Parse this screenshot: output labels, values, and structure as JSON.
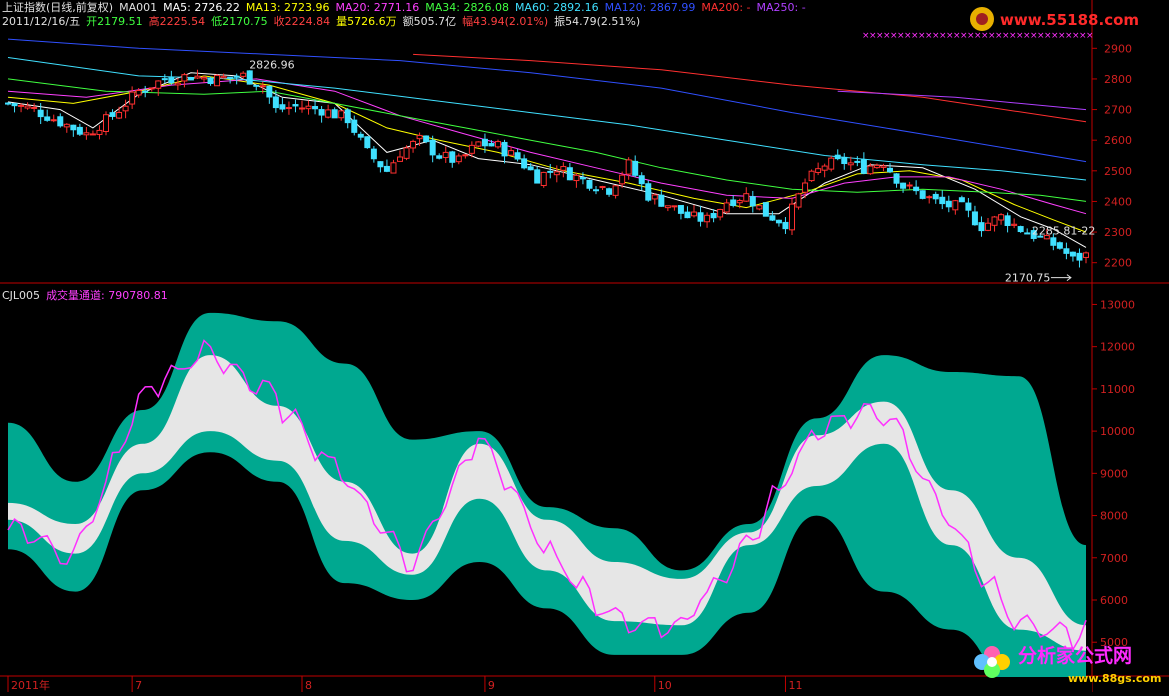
{
  "header": {
    "line1": [
      {
        "text": "上证指数(日线,前复权)",
        "color": "#e0e0e0"
      },
      {
        "text": "MA001",
        "color": "#e0e0e0"
      },
      {
        "text": "MA5: 2726.22",
        "color": "#ffffff"
      },
      {
        "text": "MA13: 2723.96",
        "color": "#ffff00"
      },
      {
        "text": "MA20: 2771.16",
        "color": "#ff40ff"
      },
      {
        "text": "MA34: 2826.08",
        "color": "#40ff40"
      },
      {
        "text": "MA60: 2892.16",
        "color": "#40e0ff"
      },
      {
        "text": "MA120: 2867.99",
        "color": "#3050ff"
      },
      {
        "text": "MA200: -",
        "color": "#ff3030"
      },
      {
        "text": "MA250: -",
        "color": "#b040ff"
      }
    ],
    "line2": [
      {
        "text": "2011/12/16/五",
        "color": "#e0e0e0"
      },
      {
        "text": "开2179.51",
        "color": "#40ff40"
      },
      {
        "text": "高2225.54",
        "color": "#ff4040"
      },
      {
        "text": "低2170.75",
        "color": "#40ff40"
      },
      {
        "text": "收2224.84",
        "color": "#ff4040"
      },
      {
        "text": "量5726.6万",
        "color": "#ffff00"
      },
      {
        "text": "额505.7亿",
        "color": "#e0e0e0"
      },
      {
        "text": "幅43.94(2.01%)",
        "color": "#ff4040"
      },
      {
        "text": "振54.79(2.51%)",
        "color": "#e0e0e0"
      }
    ],
    "indicator": [
      {
        "text": "CJL005",
        "color": "#e0e0e0"
      },
      {
        "text": "成交量通道: 790780.81",
        "color": "#ff40ff"
      }
    ]
  },
  "colors": {
    "up": "#ff3030",
    "down": "#40e0ff",
    "channel": "#00a890",
    "core": "#e6e6e6",
    "volume_line": "#ff30ff",
    "axis": "#c00000"
  },
  "chart_data": [
    {
      "type": "candlestick",
      "name": "上证指数",
      "ylim": [
        2150,
        2950
      ],
      "yticks": [
        2200,
        2300,
        2400,
        2500,
        2600,
        2700,
        2800,
        2900
      ],
      "annotations": [
        {
          "text": "2826.96",
          "index": 36,
          "value": 2826.96
        },
        {
          "text": "2285.81-22",
          "index": 161,
          "value": 2285.81
        },
        {
          "text": "2170.75",
          "index": 163,
          "value": 2170.75
        }
      ],
      "ma_lines": [
        {
          "name": "MA5",
          "color": "#ffffff",
          "points": [
            [
              0,
              2725
            ],
            [
              8,
              2700
            ],
            [
              13,
              2640
            ],
            [
              20,
              2750
            ],
            [
              28,
              2820
            ],
            [
              35,
              2810
            ],
            [
              42,
              2740
            ],
            [
              50,
              2720
            ],
            [
              58,
              2560
            ],
            [
              65,
              2600
            ],
            [
              72,
              2540
            ],
            [
              80,
              2520
            ],
            [
              90,
              2470
            ],
            [
              100,
              2420
            ],
            [
              110,
              2360
            ],
            [
              118,
              2360
            ],
            [
              125,
              2460
            ],
            [
              132,
              2520
            ],
            [
              140,
              2510
            ],
            [
              148,
              2440
            ],
            [
              155,
              2350
            ],
            [
              160,
              2310
            ],
            [
              165,
              2250
            ]
          ]
        },
        {
          "name": "MA13",
          "color": "#ffff00",
          "points": [
            [
              0,
              2740
            ],
            [
              10,
              2720
            ],
            [
              20,
              2760
            ],
            [
              30,
              2810
            ],
            [
              40,
              2780
            ],
            [
              50,
              2720
            ],
            [
              58,
              2640
            ],
            [
              66,
              2600
            ],
            [
              75,
              2560
            ],
            [
              85,
              2500
            ],
            [
              95,
              2460
            ],
            [
              105,
              2410
            ],
            [
              113,
              2380
            ],
            [
              122,
              2430
            ],
            [
              130,
              2490
            ],
            [
              138,
              2500
            ],
            [
              146,
              2470
            ],
            [
              154,
              2390
            ],
            [
              160,
              2340
            ],
            [
              165,
              2300
            ]
          ]
        },
        {
          "name": "MA20",
          "color": "#ff40ff",
          "points": [
            [
              0,
              2760
            ],
            [
              12,
              2740
            ],
            [
              25,
              2780
            ],
            [
              38,
              2800
            ],
            [
              50,
              2760
            ],
            [
              60,
              2680
            ],
            [
              70,
              2620
            ],
            [
              80,
              2560
            ],
            [
              90,
              2510
            ],
            [
              100,
              2460
            ],
            [
              110,
              2420
            ],
            [
              120,
              2410
            ],
            [
              128,
              2460
            ],
            [
              136,
              2480
            ],
            [
              144,
              2480
            ],
            [
              152,
              2440
            ],
            [
              160,
              2390
            ],
            [
              165,
              2360
            ]
          ]
        },
        {
          "name": "MA34",
          "color": "#40ff40",
          "points": [
            [
              0,
              2800
            ],
            [
              15,
              2760
            ],
            [
              30,
              2750
            ],
            [
              40,
              2760
            ],
            [
              50,
              2720
            ],
            [
              60,
              2680
            ],
            [
              70,
              2640
            ],
            [
              80,
              2600
            ],
            [
              90,
              2560
            ],
            [
              100,
              2510
            ],
            [
              110,
              2470
            ],
            [
              120,
              2440
            ],
            [
              130,
              2430
            ],
            [
              140,
              2440
            ],
            [
              150,
              2430
            ],
            [
              158,
              2420
            ],
            [
              165,
              2400
            ]
          ]
        },
        {
          "name": "MA60",
          "color": "#40e0ff",
          "points": [
            [
              0,
              2870
            ],
            [
              20,
              2810
            ],
            [
              35,
              2800
            ],
            [
              50,
              2770
            ],
            [
              65,
              2730
            ],
            [
              80,
              2690
            ],
            [
              95,
              2650
            ],
            [
              110,
              2600
            ],
            [
              125,
              2550
            ],
            [
              140,
              2520
            ],
            [
              152,
              2500
            ],
            [
              165,
              2470
            ]
          ]
        },
        {
          "name": "MA120",
          "color": "#3050ff",
          "points": [
            [
              0,
              2930
            ],
            [
              20,
              2900
            ],
            [
              40,
              2880
            ],
            [
              60,
              2860
            ],
            [
              80,
              2820
            ],
            [
              100,
              2770
            ],
            [
              120,
              2690
            ],
            [
              140,
              2620
            ],
            [
              165,
              2530
            ]
          ]
        },
        {
          "name": "MA200",
          "color": "#ff3030",
          "points": [
            [
              62,
              2880
            ],
            [
              80,
              2860
            ],
            [
              100,
              2830
            ],
            [
              120,
              2780
            ],
            [
              140,
              2740
            ],
            [
              165,
              2660
            ]
          ]
        },
        {
          "name": "MA250",
          "color": "#b040ff",
          "points": [
            [
              127,
              2760
            ],
            [
              145,
              2740
            ],
            [
              165,
              2700
            ]
          ]
        }
      ],
      "close_path": [
        [
          0,
          2720
        ],
        [
          4,
          2700
        ],
        [
          8,
          2660
        ],
        [
          12,
          2620
        ],
        [
          16,
          2680
        ],
        [
          20,
          2760
        ],
        [
          24,
          2800
        ],
        [
          28,
          2810
        ],
        [
          32,
          2800
        ],
        [
          36,
          2810
        ],
        [
          39,
          2780
        ],
        [
          41,
          2700
        ],
        [
          44,
          2710
        ],
        [
          48,
          2700
        ],
        [
          52,
          2670
        ],
        [
          55,
          2560
        ],
        [
          58,
          2500
        ],
        [
          60,
          2560
        ],
        [
          63,
          2600
        ],
        [
          66,
          2550
        ],
        [
          69,
          2530
        ],
        [
          72,
          2590
        ],
        [
          75,
          2580
        ],
        [
          78,
          2540
        ],
        [
          81,
          2480
        ],
        [
          84,
          2510
        ],
        [
          88,
          2470
        ],
        [
          92,
          2440
        ],
        [
          95,
          2520
        ],
        [
          98,
          2420
        ],
        [
          101,
          2390
        ],
        [
          104,
          2350
        ],
        [
          107,
          2340
        ],
        [
          110,
          2400
        ],
        [
          113,
          2420
        ],
        [
          116,
          2360
        ],
        [
          119,
          2330
        ],
        [
          122,
          2460
        ],
        [
          125,
          2520
        ],
        [
          128,
          2530
        ],
        [
          131,
          2510
        ],
        [
          134,
          2530
        ],
        [
          137,
          2450
        ],
        [
          140,
          2420
        ],
        [
          143,
          2390
        ],
        [
          146,
          2380
        ],
        [
          149,
          2320
        ],
        [
          152,
          2350
        ],
        [
          155,
          2310
        ],
        [
          158,
          2280
        ],
        [
          161,
          2250
        ],
        [
          163,
          2210
        ],
        [
          165,
          2225
        ]
      ],
      "xticks": [
        {
          "label": "2011年",
          "index": 0
        },
        {
          "label": "7",
          "index": 19
        },
        {
          "label": "8",
          "index": 45
        },
        {
          "label": "9",
          "index": 73
        },
        {
          "label": "10",
          "index": 99
        },
        {
          "label": "11",
          "index": 119
        }
      ]
    },
    {
      "type": "area",
      "name": "成交量通道",
      "value": 790780.81,
      "ylim": [
        4200,
        13200
      ],
      "yticks": [
        5000,
        6000,
        7000,
        8000,
        9000,
        10000,
        11000,
        12000,
        13000
      ],
      "x": [
        0,
        10,
        20,
        30,
        40,
        50,
        60,
        70,
        80,
        90,
        100,
        110,
        120,
        130,
        140,
        150,
        160
      ],
      "series": [
        {
          "role": "channel_upper",
          "values": [
            10200,
            8800,
            10500,
            12800,
            12600,
            11600,
            9800,
            10000,
            8200,
            7700,
            6700,
            7800,
            10300,
            11800,
            11400,
            11300,
            7300
          ]
        },
        {
          "role": "core_upper",
          "values": [
            8300,
            7800,
            9700,
            11800,
            10600,
            8800,
            7100,
            9700,
            7900,
            6900,
            6500,
            7600,
            9900,
            10700,
            8600,
            7000,
            5400
          ]
        },
        {
          "role": "core_lower",
          "values": [
            7900,
            7100,
            9000,
            10000,
            9300,
            7400,
            6600,
            8400,
            6700,
            5500,
            5400,
            7300,
            8700,
            9700,
            7300,
            5300,
            4800
          ]
        },
        {
          "role": "channel_lower",
          "values": [
            7200,
            6200,
            8600,
            9500,
            8800,
            6400,
            6000,
            6900,
            5800,
            4700,
            4700,
            5700,
            8000,
            6200,
            5300,
            3900,
            3600
          ]
        },
        {
          "role": "volume_line",
          "values": [
            7800,
            7000,
            10900,
            11900,
            10700,
            8900,
            6800,
            10000,
            7100,
            5500,
            5400,
            7400,
            10100,
            10500,
            7800,
            5300,
            5200
          ]
        }
      ],
      "xticks": [
        {
          "label": "2011年",
          "index": 0
        },
        {
          "label": "7",
          "index": 19
        },
        {
          "label": "8",
          "index": 45
        },
        {
          "label": "9",
          "index": 73
        },
        {
          "label": "10",
          "index": 99
        },
        {
          "label": "11",
          "index": 119
        }
      ]
    }
  ],
  "watermarks": {
    "top": "www.55188.com",
    "bottom_title": "分析家公式网",
    "bottom_url": "www.88gs.com"
  }
}
